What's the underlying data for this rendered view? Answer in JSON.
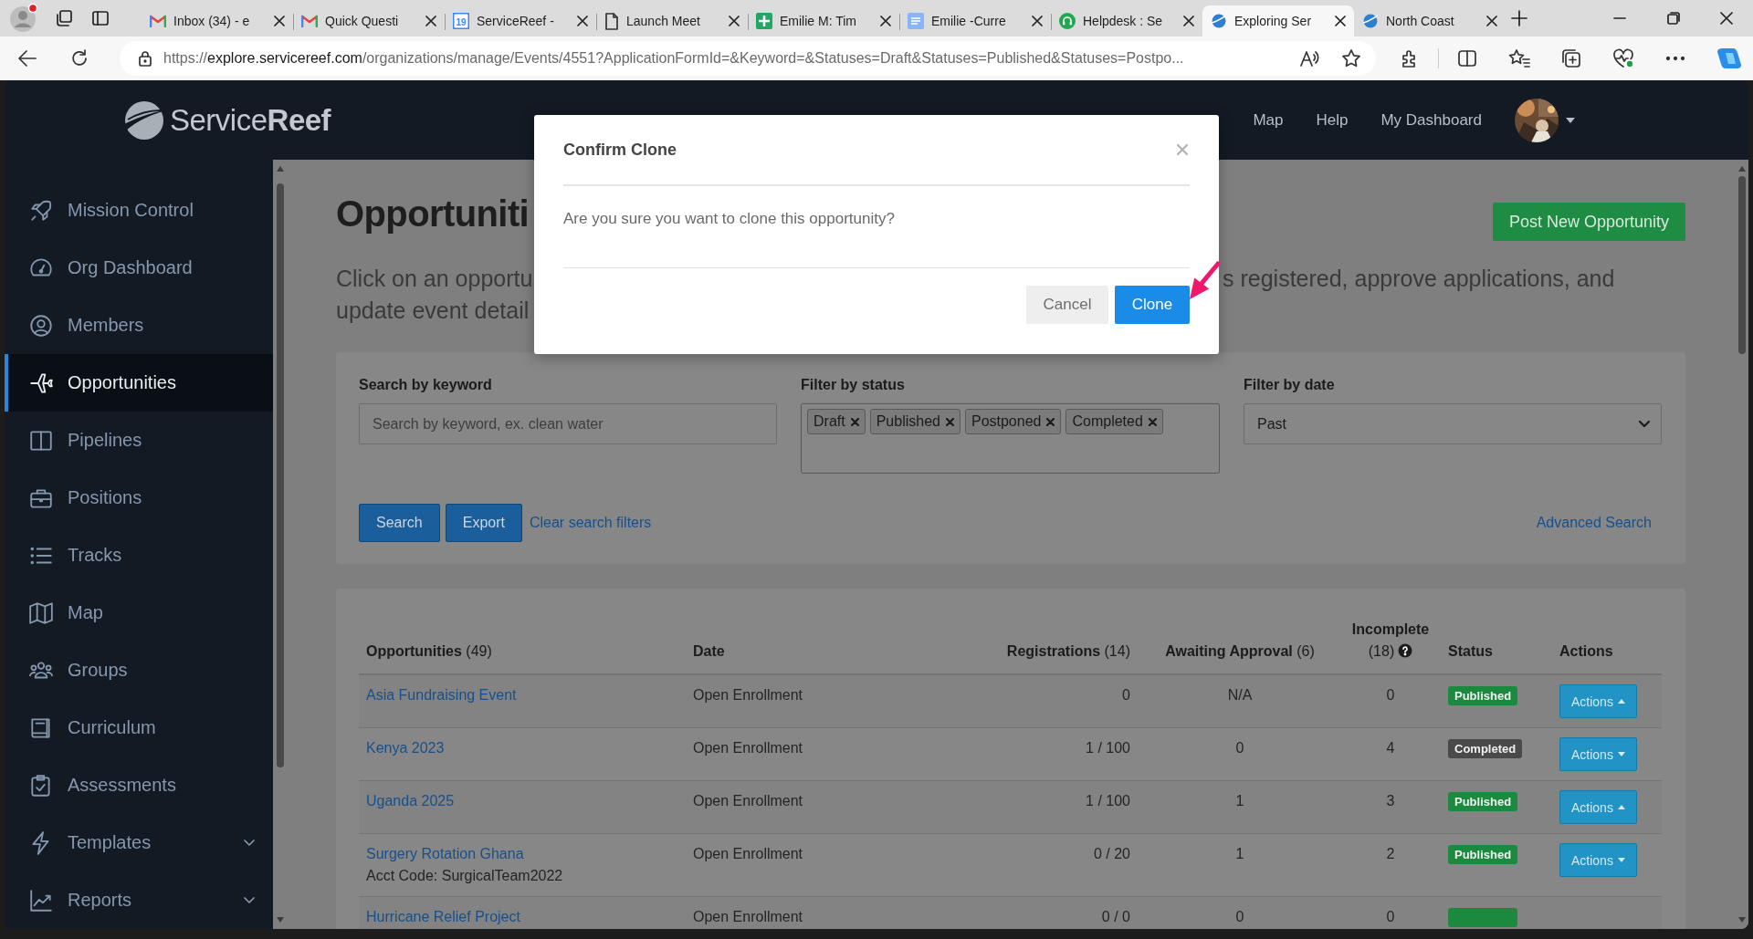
{
  "browser": {
    "tabs": [
      {
        "title": "Inbox (34) - e",
        "selected": false
      },
      {
        "title": "Quick Questi",
        "selected": false
      },
      {
        "title": "ServiceReef -",
        "favicon_text": "19",
        "selected": false
      },
      {
        "title": "Launch Meet",
        "selected": false
      },
      {
        "title": "Emilie M: Tim",
        "selected": false
      },
      {
        "title": "Emilie -Curre",
        "selected": false
      },
      {
        "title": "Helpdesk : Se",
        "selected": false
      },
      {
        "title": "Exploring Ser",
        "selected": true
      },
      {
        "title": "North Coast",
        "selected": false
      }
    ],
    "address": {
      "scheme": "https://",
      "host": "explore.servicereef.com",
      "path": "/organizations/manage/Events/4551?ApplicationFormId=&Keyword=&Statuses=Draft&Statuses=Published&Statuses=Postpo..."
    }
  },
  "header": {
    "logo": "Service**Reef**",
    "nav": [
      "Map",
      "Help",
      "My Dashboard"
    ]
  },
  "sidebar": {
    "items": [
      {
        "label": "Mission Control",
        "selected": false,
        "submenu": false
      },
      {
        "label": "Org Dashboard",
        "selected": false,
        "submenu": false
      },
      {
        "label": "Members",
        "selected": false,
        "submenu": false
      },
      {
        "label": "Opportunities",
        "selected": true,
        "submenu": false
      },
      {
        "label": "Pipelines",
        "selected": false,
        "submenu": false
      },
      {
        "label": "Positions",
        "selected": false,
        "submenu": false
      },
      {
        "label": "Tracks",
        "selected": false,
        "submenu": false
      },
      {
        "label": "Map",
        "selected": false,
        "submenu": false
      },
      {
        "label": "Groups",
        "selected": false,
        "submenu": false
      },
      {
        "label": "Curriculum",
        "selected": false,
        "submenu": false
      },
      {
        "label": "Assessments",
        "selected": false,
        "submenu": false
      },
      {
        "label": "Templates",
        "selected": false,
        "submenu": true
      },
      {
        "label": "Reports",
        "selected": false,
        "submenu": true
      }
    ]
  },
  "page": {
    "title": "Opportuniti",
    "intro_left": "Click on an opportu",
    "intro_right": "s registered, approve applications, and",
    "intro_line2": "update event detail",
    "post_button": "Post New Opportunity"
  },
  "filters": {
    "keyword": {
      "label": "Search by keyword",
      "placeholder": "Search by keyword, ex. clean water"
    },
    "status": {
      "label": "Filter by status",
      "tags": [
        "Draft",
        "Published",
        "Postponed",
        "Completed"
      ]
    },
    "date": {
      "label": "Filter by date",
      "value": "Past"
    },
    "buttons": [
      "Search",
      "Export"
    ],
    "clear_link": "Clear search filters",
    "advanced_link": "Advanced Search"
  },
  "table": {
    "columns": [
      {
        "label": "**Opportunities** (49)"
      },
      {
        "label": "**Date**"
      },
      {
        "label": "**Registrations** (14)"
      },
      {
        "label": "**Awaiting Approval** (6)"
      },
      {
        "label": "**Incomplete**",
        "count": "(18)",
        "help": true
      },
      {
        "label": "**Status**"
      },
      {
        "label": "**Actions**"
      }
    ],
    "rows": [
      {
        "name": "Asia Fundraising Event",
        "date": "Open Enrollment",
        "registrations": "0",
        "awaiting": "N/A",
        "incomplete": "0",
        "status": {
          "label": "Published",
          "color": "#1b8a3f"
        },
        "actions": "Actions",
        "expanded": true
      },
      {
        "name": "Kenya 2023",
        "date": "Open Enrollment",
        "registrations": "1 / 100",
        "awaiting": "0",
        "incomplete": "4",
        "status": {
          "label": "Completed",
          "color": "#4a4a4a"
        },
        "actions": "Actions",
        "expanded": false
      },
      {
        "name": "Uganda 2025",
        "date": "Open Enrollment",
        "registrations": "1 / 100",
        "awaiting": "1",
        "incomplete": "3",
        "status": {
          "label": "Published",
          "color": "#1b8a3f"
        },
        "actions": "Actions",
        "expanded": true
      },
      {
        "name": "Surgery Rotation Ghana",
        "acct_code": "Acct Code: SurgicalTeam2022",
        "date": "Open Enrollment",
        "registrations": "0 / 20",
        "awaiting": "1",
        "incomplete": "2",
        "status": {
          "label": "Published",
          "color": "#1b8a3f"
        },
        "actions": "Actions",
        "expanded": false
      },
      {
        "name": "Hurricane Relief Project",
        "date": "Open Enrollment",
        "registrations": "0 / 0",
        "awaiting": "0",
        "incomplete": "0",
        "status": {
          "color": "#1b8a3f"
        }
      }
    ]
  },
  "modal": {
    "title": "Confirm Clone",
    "body": "Are you sure you want to clone this opportunity?",
    "buttons": [
      {
        "label": "Cancel",
        "kind": "secondary"
      },
      {
        "label": "Clone",
        "kind": "primary"
      }
    ]
  }
}
